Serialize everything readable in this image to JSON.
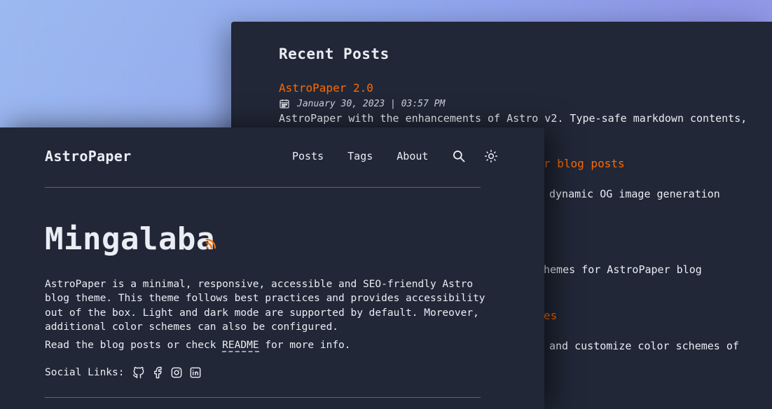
{
  "colors": {
    "background": "#212737",
    "text": "#eaedf3",
    "accent": "#ff6b01",
    "separator": "#8a5a2c"
  },
  "back_window": {
    "section_title": "Recent Posts",
    "posts": [
      {
        "title": "AstroPaper 2.0",
        "date": "January 30, 2023 | 03:57 PM",
        "desc": "AstroPaper with the enhancements of Astro v2. Type-safe markdown contents,"
      },
      {
        "title": "r blog posts",
        "desc": "dynamic OG image generation"
      },
      {
        "desc": "hemes for AstroPaper blog"
      },
      {
        "title": "es",
        "desc": "and customize color schemes of"
      }
    ]
  },
  "header": {
    "logo": "AstroPaper",
    "nav": [
      "Posts",
      "Tags",
      "About"
    ],
    "icons": [
      "search-icon",
      "theme-toggle-sun-icon"
    ]
  },
  "hero": {
    "title": "Mingalaba",
    "rss_icon": "rss-icon",
    "description": "AstroPaper is a minimal, responsive, accessible and SEO-friendly Astro blog theme. This theme follows best practices and provides accessibility out of the box. Light and dark mode are supported by default. Moreover, additional color schemes can also be configured.",
    "readme_prefix": "Read the blog posts or check ",
    "readme_link": "README",
    "readme_suffix": " for more info."
  },
  "social": {
    "label": "Social Links:",
    "icons": [
      "github-icon",
      "facebook-icon",
      "instagram-icon",
      "linkedin-icon"
    ]
  }
}
